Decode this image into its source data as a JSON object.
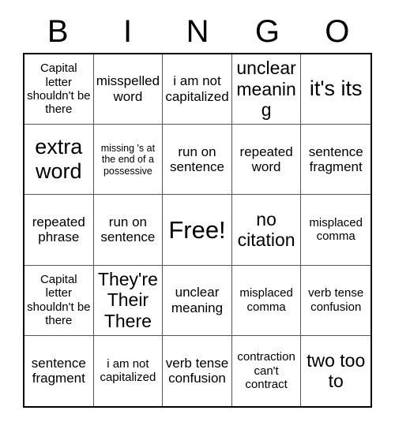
{
  "header": {
    "letters": [
      "B",
      "I",
      "N",
      "G",
      "O"
    ]
  },
  "grid": {
    "columns": 5,
    "rows": 5,
    "border_color": "#000000",
    "cell_border_color": "#555555",
    "background": "#ffffff",
    "text_color": "#000000"
  },
  "cells": [
    {
      "text": "Capital letter shouldn't be there",
      "size": "sz-small"
    },
    {
      "text": "misspelled word",
      "size": "sz-medium"
    },
    {
      "text": "i am not capitalized",
      "size": "sz-medium"
    },
    {
      "text": "unclear meaning",
      "size": "sz-large"
    },
    {
      "text": "it's its",
      "size": "sz-xlarge"
    },
    {
      "text": "extra word",
      "size": "sz-xlarge"
    },
    {
      "text": "missing 's at the end of a possessive",
      "size": "sz-xsmall"
    },
    {
      "text": "run on sentence",
      "size": "sz-medium"
    },
    {
      "text": "repeated word",
      "size": "sz-medium"
    },
    {
      "text": "sentence fragment",
      "size": "sz-medium"
    },
    {
      "text": "repeated phrase",
      "size": "sz-medium"
    },
    {
      "text": "run on sentence",
      "size": "sz-medium"
    },
    {
      "text": "Free!",
      "size": "sz-free"
    },
    {
      "text": "no citation",
      "size": "sz-large"
    },
    {
      "text": "misplaced comma",
      "size": "sz-small"
    },
    {
      "text": "Capital letter shouldn't be there",
      "size": "sz-small"
    },
    {
      "text": "They're Their There",
      "size": "sz-large"
    },
    {
      "text": "unclear meaning",
      "size": "sz-medium"
    },
    {
      "text": "misplaced comma",
      "size": "sz-small"
    },
    {
      "text": "verb tense confusion",
      "size": "sz-small"
    },
    {
      "text": "sentence fragment",
      "size": "sz-medium"
    },
    {
      "text": "i am not capitalized",
      "size": "sz-small"
    },
    {
      "text": "verb tense confusion",
      "size": "sz-medium"
    },
    {
      "text": "contraction can't contract",
      "size": "sz-small"
    },
    {
      "text": "two too to",
      "size": "sz-large"
    }
  ]
}
